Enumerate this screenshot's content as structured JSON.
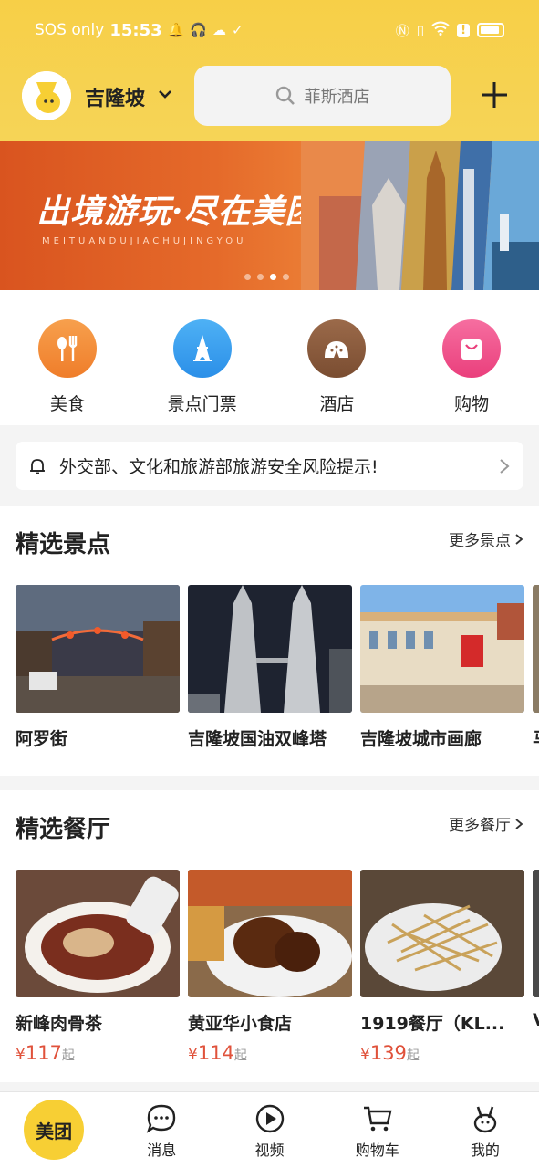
{
  "status_bar": {
    "carrier": "SOS only",
    "time": "15:53",
    "left_icons": [
      "bell-icon",
      "headphones-icon",
      "cloud-icon",
      "check-icon"
    ],
    "right_icons": [
      "nfc-icon",
      "vibrate-icon",
      "wifi-icon",
      "alert-icon",
      "battery-icon"
    ]
  },
  "header": {
    "city": "吉隆坡",
    "search_placeholder": "菲斯酒店",
    "avatar": "user-avatar"
  },
  "banner": {
    "title": "出境游玩·尽在美团",
    "subtitle": "MEITUANDUJIACHUJINGYOU",
    "active_index": 2,
    "count": 4
  },
  "categories": [
    {
      "label": "美食",
      "icon": "food-icon",
      "color": "#f38a35"
    },
    {
      "label": "景点门票",
      "icon": "eiffel-tower-icon",
      "color": "#2e9bf0"
    },
    {
      "label": "酒店",
      "icon": "hotel-icon",
      "color": "#8b5a3c"
    },
    {
      "label": "购物",
      "icon": "shopping-bag-icon",
      "color": "#f04e8a"
    }
  ],
  "notice": {
    "text": "外交部、文化和旅游部旅游安全风险提示!"
  },
  "attractions": {
    "title": "精选景点",
    "more": "更多景点",
    "items": [
      {
        "name": "阿罗街"
      },
      {
        "name": "吉隆坡国油双峰塔"
      },
      {
        "name": "吉隆坡城市画廊"
      }
    ],
    "peek": "马"
  },
  "restaurants": {
    "title": "精选餐厅",
    "more": "更多餐厅",
    "items": [
      {
        "name": "新峰肉骨茶",
        "currency": "¥",
        "price": "117",
        "suffix": "起"
      },
      {
        "name": "黄亚华小食店",
        "currency": "¥",
        "price": "114",
        "suffix": "起"
      },
      {
        "name": "1919餐厅（KL...",
        "currency": "¥",
        "price": "139",
        "suffix": "起"
      }
    ],
    "peek": "V"
  },
  "tabbar": [
    {
      "label": "美团",
      "icon": "meituan-home-icon",
      "active": true
    },
    {
      "label": "消息",
      "icon": "message-icon"
    },
    {
      "label": "视频",
      "icon": "video-play-icon"
    },
    {
      "label": "购物车",
      "icon": "cart-icon"
    },
    {
      "label": "我的",
      "icon": "profile-icon"
    }
  ],
  "colors": {
    "brand_yellow": "#f7cf47",
    "price_red": "#e0523b"
  }
}
